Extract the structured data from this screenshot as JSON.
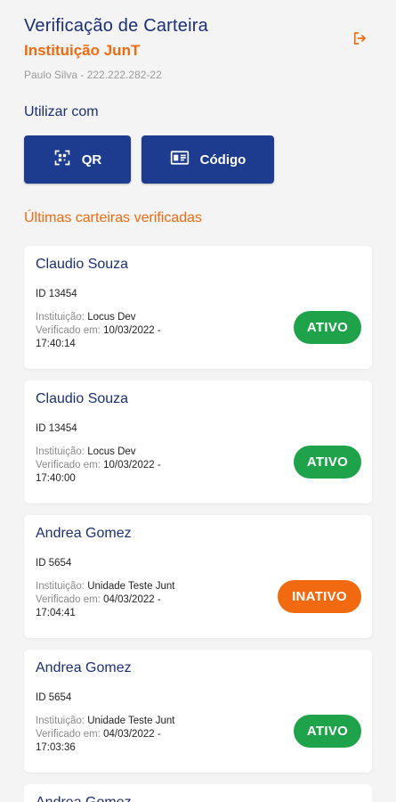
{
  "header": {
    "title": "Verificação de Carteira",
    "institution": "Instituição JunT",
    "user": "Paulo Silva - 222.222.282-22"
  },
  "use_with": {
    "label": "Utilizar com",
    "qr_label": "QR",
    "code_label": "Código"
  },
  "recent": {
    "title": "Últimas carteiras verificadas",
    "inst_label": "Instituição:",
    "verified_label": "Verificado em:",
    "items": [
      {
        "name": "Claudio Souza",
        "id": "ID 13454",
        "institution": "Locus Dev",
        "verified": "10/03/2022 -",
        "time": "17:40:14",
        "status": "ATIVO"
      },
      {
        "name": "Claudio Souza",
        "id": "ID 13454",
        "institution": "Locus Dev",
        "verified": "10/03/2022 -",
        "time": "17:40:00",
        "status": "ATIVO"
      },
      {
        "name": "Andrea Gomez",
        "id": "ID 5654",
        "institution": "Unidade Teste Junt",
        "verified": "04/03/2022 -",
        "time": "17:04:41",
        "status": "INATIVO"
      },
      {
        "name": "Andrea Gomez",
        "id": "ID 5654",
        "institution": "Unidade Teste Junt",
        "verified": "04/03/2022 -",
        "time": "17:03:36",
        "status": "ATIVO"
      }
    ],
    "partial_name": "Andrea Gomez"
  },
  "colors": {
    "primary": "#1e3c8f",
    "accent": "#f26a10",
    "active": "#1fa34a"
  }
}
